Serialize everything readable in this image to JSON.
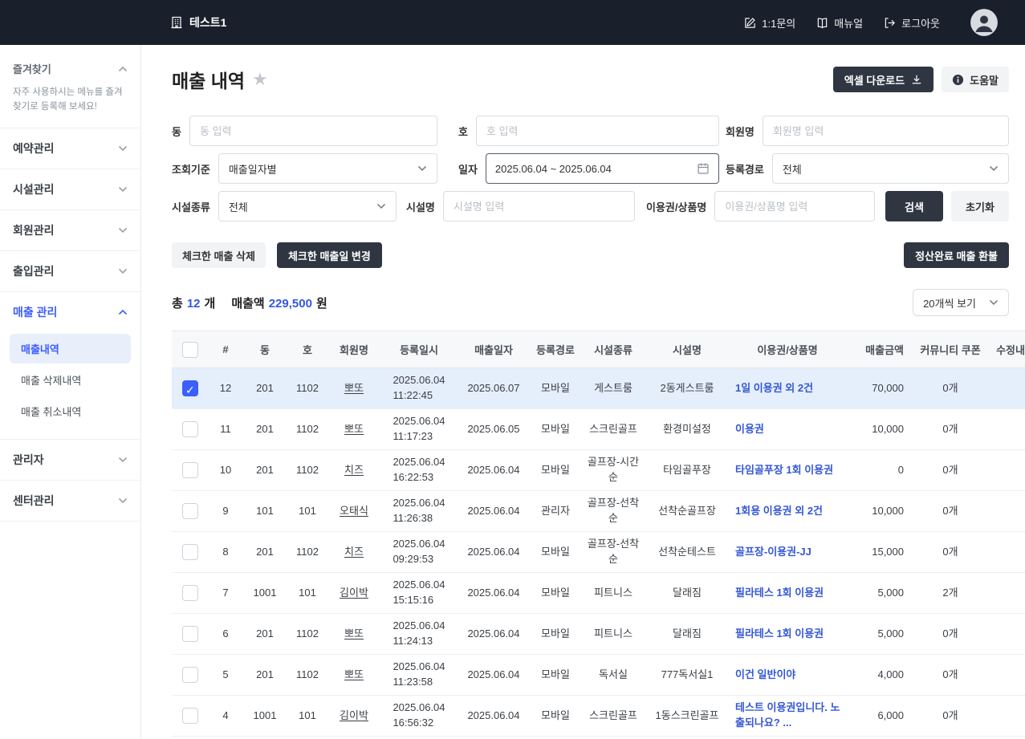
{
  "colors": {
    "topbar_bg": "#1a202b",
    "accent_blue": "#3b5efc",
    "link_blue": "#3457d5",
    "dark_button": "#2f3642",
    "selected_row_bg": "#e5eefb"
  },
  "topbar": {
    "brand": "테스트1",
    "links": [
      {
        "label": "1:1문의",
        "icon": "pencil-square-icon"
      },
      {
        "label": "매뉴얼",
        "icon": "book-icon"
      },
      {
        "label": "로그아웃",
        "icon": "logout-icon"
      }
    ]
  },
  "sidebar": {
    "favorites_title": "즐겨찾기",
    "favorites_hint": "자주 사용하시는 메뉴를 즐겨찾기로 등록해 보세요!",
    "sections": [
      {
        "label": "예약관리"
      },
      {
        "label": "시설관리"
      },
      {
        "label": "회원관리"
      },
      {
        "label": "출입관리"
      },
      {
        "label": "매출 관리",
        "children": [
          "매출내역",
          "매출 삭제내역",
          "매출 취소내역"
        ]
      },
      {
        "label": "관리자"
      },
      {
        "label": "센터관리"
      }
    ]
  },
  "page": {
    "title": "매출 내역",
    "excel_button": "엑셀 다운로드",
    "help_button": "도움말"
  },
  "filters": {
    "dong": {
      "label": "동",
      "placeholder": "동 입력"
    },
    "ho": {
      "label": "호",
      "placeholder": "호 입력"
    },
    "member": {
      "label": "회원명",
      "placeholder": "회원명 입력"
    },
    "criteria": {
      "label": "조회기준",
      "value": "매출일자별"
    },
    "date": {
      "label": "일자",
      "value": "2025.06.04 ~ 2025.06.04"
    },
    "channel": {
      "label": "등록경로",
      "value": "전체"
    },
    "facility_type": {
      "label": "시설종류",
      "value": "전체"
    },
    "facility_name": {
      "label": "시설명",
      "placeholder": "시설명 입력"
    },
    "product": {
      "label": "이용권/상품명",
      "placeholder": "이용권/상품명 입력"
    },
    "search_button": "검색",
    "reset_button": "초기화"
  },
  "actions": {
    "delete_checked": "체크한 매출 삭제",
    "change_sale_date": "체크한 매출일 변경",
    "refund_settled": "정산완료 매출 환불"
  },
  "summary": {
    "total_prefix": "총",
    "total_count": "12",
    "total_suffix": "개",
    "amount_label": "매출액",
    "amount_value": "229,500",
    "amount_suffix": "원",
    "page_size_value": "20개씩 보기"
  },
  "table": {
    "headers": [
      "#",
      "동",
      "호",
      "회원명",
      "등록일시",
      "매출일자",
      "등록경로",
      "시설종류",
      "시설명",
      "이용권/상품명",
      "매출금액",
      "커뮤니티 쿠폰",
      "수정내역"
    ],
    "rows": [
      {
        "checked": true,
        "num": "12",
        "dong": "201",
        "ho": "1102",
        "member": "뽀또",
        "reg_date": "2025.06.04",
        "reg_time": "11:22:45",
        "sale_date": "2025.06.07",
        "channel": "모바일",
        "facility_type": "게스트룸",
        "facility_name": "2동게스트룸",
        "product": "1일 이용권 외 2건",
        "amount": "70,000",
        "coupon": "0개"
      },
      {
        "checked": false,
        "num": "11",
        "dong": "201",
        "ho": "1102",
        "member": "뽀또",
        "reg_date": "2025.06.04",
        "reg_time": "11:17:23",
        "sale_date": "2025.06.05",
        "channel": "모바일",
        "facility_type": "스크린골프",
        "facility_name": "환경미설정",
        "product": "이용권",
        "amount": "10,000",
        "coupon": "0개"
      },
      {
        "checked": false,
        "num": "10",
        "dong": "201",
        "ho": "1102",
        "member": "치즈",
        "reg_date": "2025.06.04",
        "reg_time": "16:22:53",
        "sale_date": "2025.06.04",
        "channel": "모바일",
        "facility_type": "골프장-시간순",
        "facility_name": "타임골푸장",
        "product": "타임골푸장 1회 이용권",
        "amount": "0",
        "coupon": "0개"
      },
      {
        "checked": false,
        "num": "9",
        "dong": "101",
        "ho": "101",
        "member": "오태식",
        "reg_date": "2025.06.04",
        "reg_time": "11:26:38",
        "sale_date": "2025.06.04",
        "channel": "관리자",
        "facility_type": "골프장-선착순",
        "facility_name": "선착순골프장",
        "product": "1회용 이용권 외 2건",
        "amount": "10,000",
        "coupon": "0개"
      },
      {
        "checked": false,
        "num": "8",
        "dong": "201",
        "ho": "1102",
        "member": "치즈",
        "reg_date": "2025.06.04",
        "reg_time": "09:29:53",
        "sale_date": "2025.06.04",
        "channel": "모바일",
        "facility_type": "골프장-선착순",
        "facility_name": "선착순테스트",
        "product": "골프장-이용권-JJ",
        "amount": "15,000",
        "coupon": "0개"
      },
      {
        "checked": false,
        "num": "7",
        "dong": "1001",
        "ho": "101",
        "member": "김이박",
        "reg_date": "2025.06.04",
        "reg_time": "15:15:16",
        "sale_date": "2025.06.04",
        "channel": "모바일",
        "facility_type": "피트니스",
        "facility_name": "달래짐",
        "product": "필라테스 1회 이용권",
        "amount": "5,000",
        "coupon": "2개"
      },
      {
        "checked": false,
        "num": "6",
        "dong": "201",
        "ho": "1102",
        "member": "뽀또",
        "reg_date": "2025.06.04",
        "reg_time": "11:24:13",
        "sale_date": "2025.06.04",
        "channel": "모바일",
        "facility_type": "피트니스",
        "facility_name": "달래짐",
        "product": "필라테스 1회 이용권",
        "amount": "5,000",
        "coupon": "0개"
      },
      {
        "checked": false,
        "num": "5",
        "dong": "201",
        "ho": "1102",
        "member": "뽀또",
        "reg_date": "2025.06.04",
        "reg_time": "11:23:58",
        "sale_date": "2025.06.04",
        "channel": "모바일",
        "facility_type": "독서실",
        "facility_name": "777독서실1",
        "product": "이건 일반이야",
        "amount": "4,000",
        "coupon": "0개"
      },
      {
        "checked": false,
        "num": "4",
        "dong": "1001",
        "ho": "101",
        "member": "김이박",
        "reg_date": "2025.06.04",
        "reg_time": "16:56:32",
        "sale_date": "2025.06.04",
        "channel": "모바일",
        "facility_type": "스크린골프",
        "facility_name": "1동스크린골프",
        "product": "테스트 이용권입니다. 노출되나요? ...",
        "amount": "6,000",
        "coupon": "0개"
      }
    ]
  }
}
